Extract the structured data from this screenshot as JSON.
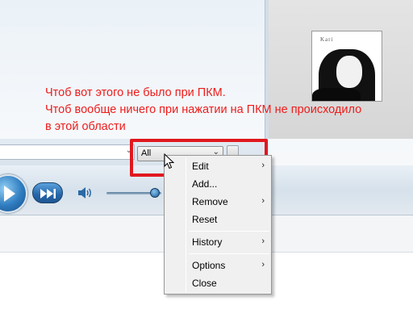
{
  "annotation": {
    "line1": "Чтоб вот этого не было при ПКМ.",
    "line2": "Чтоб вообще ничего при нажатии на ПКМ не происходило",
    "line3": "в этой области"
  },
  "album": {
    "title": "Kari"
  },
  "toolbar": {
    "filter_value": "All"
  },
  "colors": {
    "annotation_red": "#ee1c1c",
    "player_blue": "#2565a8"
  },
  "context_menu": {
    "items": [
      {
        "label": "Edit",
        "submenu": "›"
      },
      {
        "label": "Add...",
        "submenu": ""
      },
      {
        "label": "Remove",
        "submenu": "›"
      },
      {
        "label": "Reset",
        "submenu": ""
      },
      {
        "label": "History",
        "submenu": "›"
      },
      {
        "label": "Options",
        "submenu": "›"
      },
      {
        "label": "Close",
        "submenu": ""
      }
    ]
  }
}
